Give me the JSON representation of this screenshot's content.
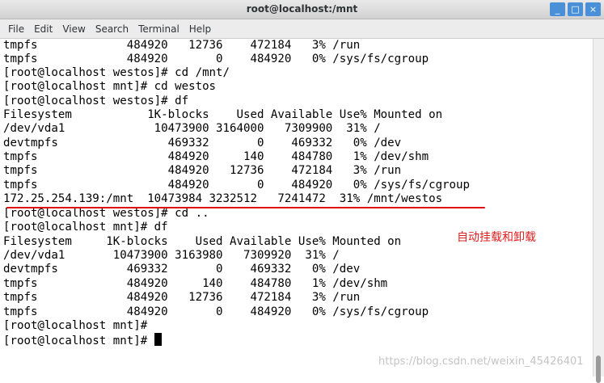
{
  "window": {
    "title": "root@localhost:/mnt",
    "buttons": {
      "minimize": "_",
      "maximize": "□",
      "close": "×"
    }
  },
  "menu": [
    "File",
    "Edit",
    "View",
    "Search",
    "Terminal",
    "Help"
  ],
  "terminal": {
    "lines": [
      "tmpfs             484920   12736    472184   3% /run",
      "tmpfs             484920       0    484920   0% /sys/fs/cgroup",
      "[root@localhost westos]# cd /mnt/",
      "[root@localhost mnt]# cd westos",
      "[root@localhost westos]# df",
      "Filesystem           1K-blocks    Used Available Use% Mounted on",
      "/dev/vda1             10473900 3164000   7309900  31% /",
      "devtmpfs                469332       0    469332   0% /dev",
      "tmpfs                   484920     140    484780   1% /dev/shm",
      "tmpfs                   484920   12736    472184   3% /run",
      "tmpfs                   484920       0    484920   0% /sys/fs/cgroup",
      "172.25.254.139:/mnt  10473984 3232512   7241472  31% /mnt/westos",
      "[root@localhost westos]# cd ..",
      "[root@localhost mnt]# df",
      "Filesystem     1K-blocks    Used Available Use% Mounted on",
      "/dev/vda1       10473900 3163980   7309920  31% /",
      "devtmpfs          469332       0    469332   0% /dev",
      "tmpfs             484920     140    484780   1% /dev/shm",
      "tmpfs             484920   12736    472184   3% /run",
      "tmpfs             484920       0    484920   0% /sys/fs/cgroup",
      "[root@localhost mnt]#",
      "[root@localhost mnt]# "
    ]
  },
  "annotation": "自动挂载和卸载",
  "watermark": "https://blog.csdn.net/weixin_45426401",
  "colors": {
    "annotation": "#e02020",
    "underline": "#e01010",
    "titlebar_button": "#4a90d9"
  }
}
